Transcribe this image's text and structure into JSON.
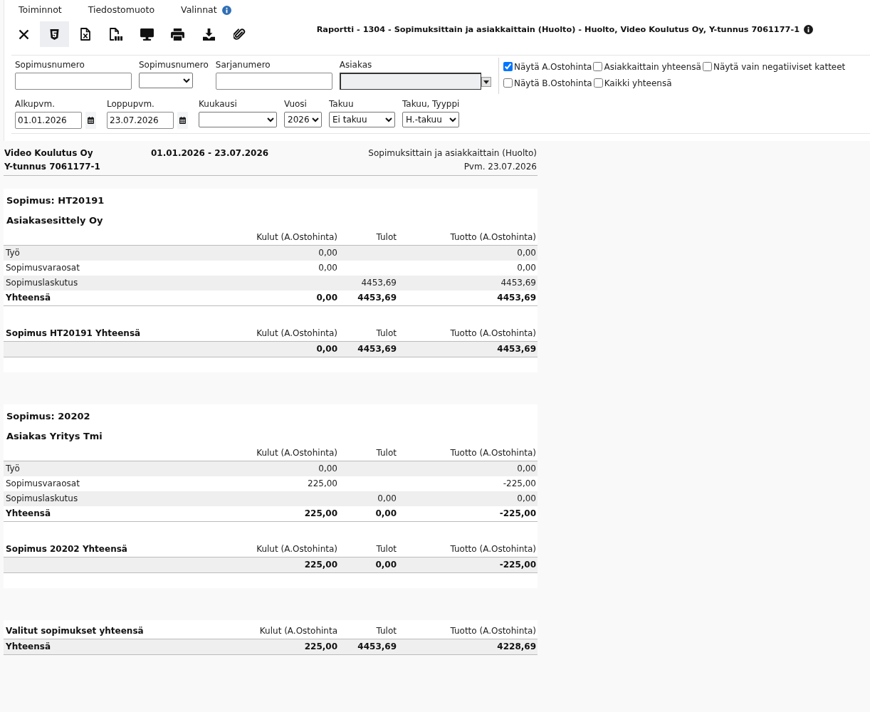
{
  "menu": [
    {
      "label": "Toiminnot",
      "info": false
    },
    {
      "label": "Tiedostomuoto",
      "info": false
    },
    {
      "label": "Valinnat",
      "info": true
    }
  ],
  "toolbar": [
    {
      "kind": "close",
      "selected": false
    },
    {
      "kind": "html",
      "selected": true
    },
    {
      "kind": "excel",
      "selected": false
    },
    {
      "kind": "pdf",
      "selected": false
    },
    {
      "kind": "screen",
      "selected": false
    },
    {
      "kind": "print",
      "selected": false
    },
    {
      "kind": "download",
      "selected": false
    },
    {
      "kind": "attach",
      "selected": false
    }
  ],
  "report_title": {
    "text": "Raportti - 1304 - Sopimuksittain ja asiakkaittain (Huolto) - Huolto, Video Koulutus Oy, Y-tunnus 7061177-1",
    "info": true
  },
  "filter_rows": [
    {
      "fields": [
        {
          "kind": "text",
          "label": "Sopimusnumero",
          "disabled": false
        },
        {
          "kind": "select",
          "label": "Sopimusnumero",
          "disabled": false
        },
        {
          "kind": "text",
          "label": "Sarjanumero",
          "disabled": false
        },
        {
          "kind": "combo",
          "label": "Asiakas",
          "disabled": true
        }
      ]
    },
    {
      "fields": [
        {
          "kind": "date",
          "label": "Alkupvm.",
          "value": "01.01.2026",
          "disabled": false
        },
        {
          "kind": "date",
          "label": "Loppupvm.",
          "value": "23.07.2026",
          "disabled": false
        },
        {
          "kind": "select",
          "label": "Kuukausi",
          "disabled": false
        },
        {
          "kind": "select",
          "label": "Vuosi",
          "value": "2026",
          "disabled": false
        },
        {
          "kind": "select",
          "label": "Takuu",
          "value": "Ei takuu",
          "disabled": false
        },
        {
          "kind": "select",
          "label": "Takuu, Tyyppi",
          "value": "H.-takuu",
          "disabled": false
        }
      ]
    }
  ],
  "option_rows": [
    {
      "options": [
        {
          "label": "Näytä A.Ostohinta",
          "checked": true
        },
        {
          "label": "Asiakkaittain yhteensä",
          "checked": false
        },
        {
          "label": "Näytä vain negatiiviset katteet",
          "checked": false
        }
      ]
    },
    {
      "options": [
        {
          "label": "Näytä B.Ostohinta",
          "checked": false
        },
        {
          "label": "Kaikki yhteensä",
          "checked": false
        }
      ]
    }
  ],
  "report_header": {
    "company": "Video Koulutus Oy",
    "business_id": "Y-tunnus 7061177-1",
    "period": "01.01.2026 - 23.07.2026",
    "report_name": "Sopimuksittain ja asiakkaittain (Huolto)",
    "date": "Pvm. 23.07.2026"
  },
  "contracts": [
    {
      "title": "Sopimus: HT20191",
      "customer": "Asiakasesittely Oy",
      "columns": [
        "Kulut (A.Ostohinta)",
        "Tulot",
        "Tuotto (A.Ostohinta)"
      ],
      "rows": [
        {
          "kind": "line",
          "label": "Työ",
          "costs": "0,00",
          "profit": "0,00"
        },
        {
          "kind": "line",
          "label": "Sopimusvaraosat",
          "costs": "0,00",
          "profit": "0,00"
        },
        {
          "kind": "line",
          "label": "Sopimuslaskutus",
          "income": "4453,69",
          "profit": "4453,69"
        },
        {
          "kind": "total",
          "label": "Yhteensä",
          "costs": "0,00",
          "income": "4453,69",
          "profit": "4453,69"
        }
      ],
      "summary": {
        "title": "Sopimus HT20191 Yhteensä",
        "columns": [
          "Kulut (A.Ostohinta)",
          "Tulot",
          "Tuotto (A.Ostohinta)"
        ],
        "costs": "0,00",
        "income": "4453,69",
        "profit": "4453,69"
      }
    },
    {
      "title": "Sopimus: 20202",
      "customer": "Asiakas Yritys Tmi",
      "columns": [
        "Kulut (A.Ostohinta)",
        "Tulot",
        "Tuotto (A.Ostohinta)"
      ],
      "rows": [
        {
          "kind": "line",
          "label": "Työ",
          "costs": "0,00",
          "profit": "0,00"
        },
        {
          "kind": "line",
          "label": "Sopimusvaraosat",
          "costs": "225,00",
          "profit": "-225,00"
        },
        {
          "kind": "line",
          "label": "Sopimuslaskutus",
          "income": "0,00",
          "profit": "0,00"
        },
        {
          "kind": "total",
          "label": "Yhteensä",
          "costs": "225,00",
          "income": "0,00",
          "profit": "-225,00"
        }
      ],
      "summary": {
        "title": "Sopimus 20202 Yhteensä",
        "columns": [
          "Kulut (A.Ostohinta)",
          "Tulot",
          "Tuotto (A.Ostohinta)"
        ],
        "costs": "225,00",
        "income": "0,00",
        "profit": "-225,00"
      }
    }
  ],
  "grand_total": {
    "title": "Valitut sopimukset yhteensä",
    "columns": [
      "Kulut (A.Ostohinta",
      "Tulot",
      "Tuotto (A.Ostohinta)"
    ],
    "label": "Yhteensä",
    "costs": "225,00",
    "income": "4453,69",
    "profit": "4228,69"
  }
}
